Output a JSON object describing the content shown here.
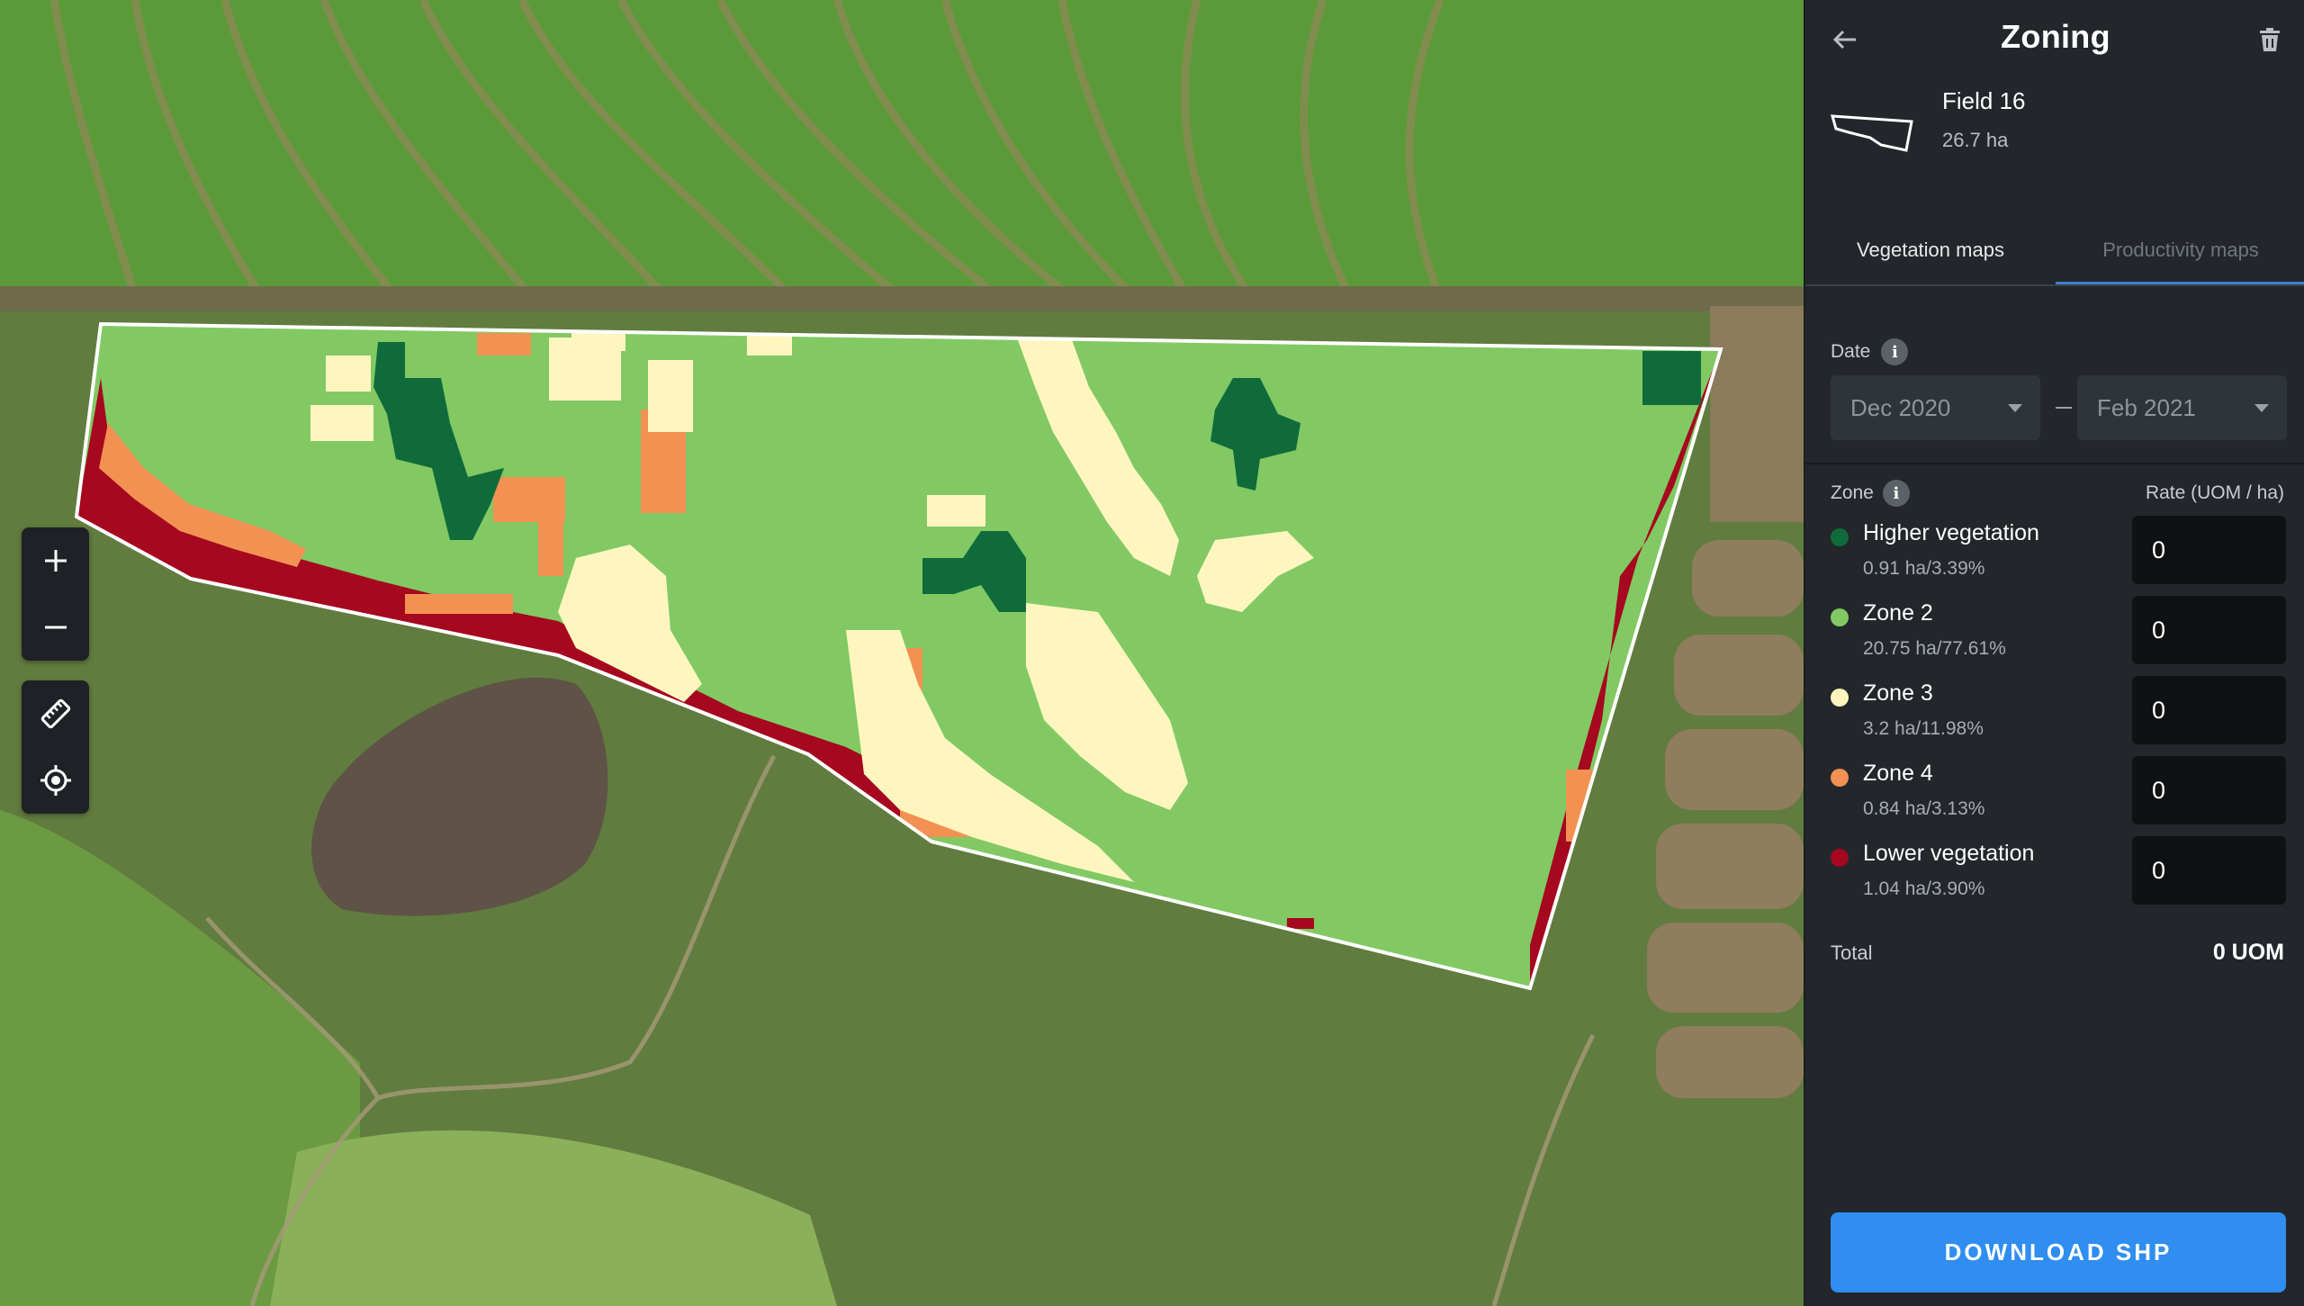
{
  "header": {
    "back_icon": "arrow-left-icon",
    "title": "Zoning",
    "delete_icon": "trash-icon"
  },
  "field": {
    "name": "Field 16",
    "area": "26.7 ha"
  },
  "tabs": [
    {
      "label": "Vegetation maps",
      "active": true
    },
    {
      "label": "Productivity maps",
      "active": false
    }
  ],
  "date": {
    "label": "Date",
    "from": "Dec 2020",
    "to": "Feb 2021"
  },
  "zones_header": {
    "zone_label": "Zone",
    "rate_label": "Rate (UOM / ha)"
  },
  "zones": [
    {
      "name": "Higher vegetation",
      "stats": "0.91 ha/3.39%",
      "color": "#0f6b3a",
      "rate": "0"
    },
    {
      "name": "Zone 2",
      "stats": "20.75 ha/77.61%",
      "color": "#82c964",
      "rate": "0"
    },
    {
      "name": "Zone 3",
      "stats": "3.2 ha/11.98%",
      "color": "#fff6bf",
      "rate": "0"
    },
    {
      "name": "Zone 4",
      "stats": "0.84 ha/3.13%",
      "color": "#f39152",
      "rate": "0"
    },
    {
      "name": "Lower vegetation",
      "stats": "1.04 ha/3.90%",
      "color": "#a5081f",
      "rate": "0"
    }
  ],
  "total": {
    "label": "Total",
    "value": "0 UOM"
  },
  "download_button": "DOWNLOAD SHP",
  "map_controls": [
    "zoom-in-icon",
    "zoom-out-icon",
    "ruler-icon",
    "locate-icon"
  ]
}
